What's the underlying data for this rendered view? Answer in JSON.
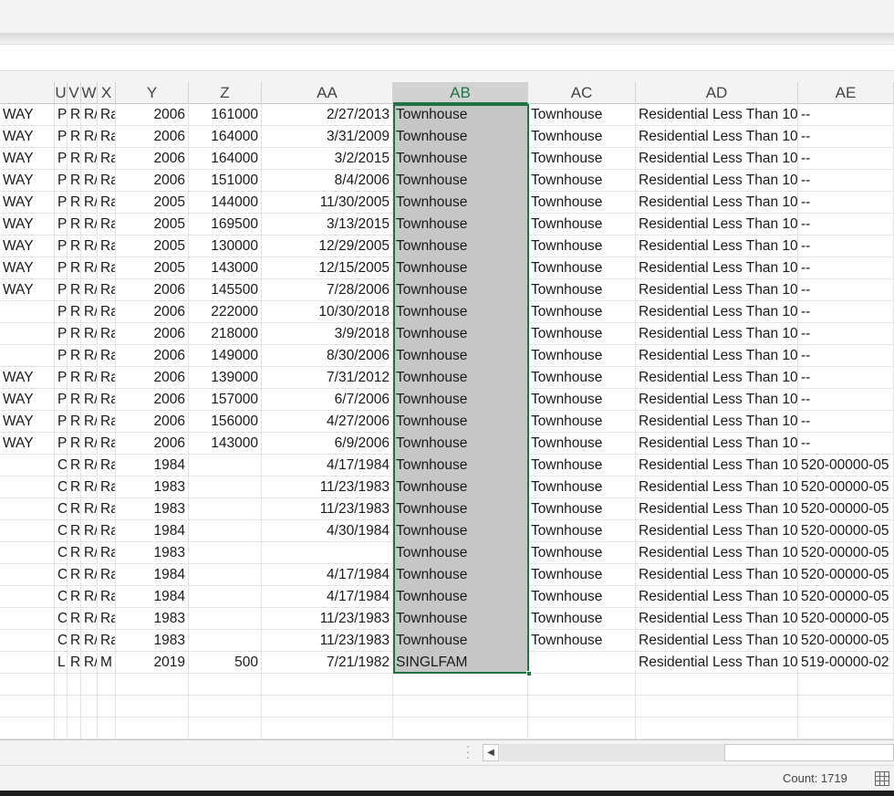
{
  "columns": [
    "",
    "U",
    "V",
    "W",
    "X",
    "Y",
    "Z",
    "AA",
    "AB",
    "AC",
    "AD",
    "AE"
  ],
  "selected_column": "AB",
  "rows": [
    [
      "WAY",
      "P",
      "R/",
      "R/",
      "Ra",
      "2006",
      "161000",
      "2/27/2013",
      "Townhouse",
      "Townhouse",
      "Residential Less Than 10",
      "--"
    ],
    [
      "WAY",
      "P",
      "R/",
      "R/",
      "Ra",
      "2006",
      "164000",
      "3/31/2009",
      "Townhouse",
      "Townhouse",
      "Residential Less Than 10",
      "--"
    ],
    [
      "WAY",
      "P",
      "R/",
      "R/",
      "Ra",
      "2006",
      "164000",
      "3/2/2015",
      "Townhouse",
      "Townhouse",
      "Residential Less Than 10",
      "--"
    ],
    [
      "WAY",
      "P",
      "R/",
      "R/",
      "Ra",
      "2006",
      "151000",
      "8/4/2006",
      "Townhouse",
      "Townhouse",
      "Residential Less Than 10",
      "--"
    ],
    [
      "WAY",
      "P",
      "R/",
      "R/",
      "Ra",
      "2005",
      "144000",
      "11/30/2005",
      "Townhouse",
      "Townhouse",
      "Residential Less Than 10",
      "--"
    ],
    [
      "WAY",
      "P",
      "R/",
      "R/",
      "Ra",
      "2005",
      "169500",
      "3/13/2015",
      "Townhouse",
      "Townhouse",
      "Residential Less Than 10",
      "--"
    ],
    [
      "WAY",
      "P",
      "R/",
      "R/",
      "Ra",
      "2005",
      "130000",
      "12/29/2005",
      "Townhouse",
      "Townhouse",
      "Residential Less Than 10",
      "--"
    ],
    [
      "WAY",
      "P",
      "R/",
      "R/",
      "Ra",
      "2005",
      "143000",
      "12/15/2005",
      "Townhouse",
      "Townhouse",
      "Residential Less Than 10",
      "--"
    ],
    [
      "WAY",
      "P",
      "R/",
      "R/",
      "Ra",
      "2006",
      "145500",
      "7/28/2006",
      "Townhouse",
      "Townhouse",
      "Residential Less Than 10",
      "--"
    ],
    [
      "",
      "P",
      "R/",
      "R/",
      "Ra",
      "2006",
      "222000",
      "10/30/2018",
      "Townhouse",
      "Townhouse",
      "Residential Less Than 10",
      "--"
    ],
    [
      "",
      "P",
      "R/",
      "R/",
      "Ra",
      "2006",
      "218000",
      "3/9/2018",
      "Townhouse",
      "Townhouse",
      "Residential Less Than 10",
      "--"
    ],
    [
      "",
      "P",
      "R/",
      "R/",
      "Ra",
      "2006",
      "149000",
      "8/30/2006",
      "Townhouse",
      "Townhouse",
      "Residential Less Than 10",
      "--"
    ],
    [
      "WAY",
      "P",
      "R/",
      "R/",
      "Ra",
      "2006",
      "139000",
      "7/31/2012",
      "Townhouse",
      "Townhouse",
      "Residential Less Than 10",
      "--"
    ],
    [
      "WAY",
      "P",
      "R/",
      "R/",
      "Ra",
      "2006",
      "157000",
      "6/7/2006",
      "Townhouse",
      "Townhouse",
      "Residential Less Than 10",
      "--"
    ],
    [
      "WAY",
      "P",
      "R/",
      "R/",
      "Ra",
      "2006",
      "156000",
      "4/27/2006",
      "Townhouse",
      "Townhouse",
      "Residential Less Than 10",
      "--"
    ],
    [
      "WAY",
      "P",
      "R/",
      "R/",
      "Ra",
      "2006",
      "143000",
      "6/9/2006",
      "Townhouse",
      "Townhouse",
      "Residential Less Than 10",
      "--"
    ],
    [
      "",
      "C",
      "R/",
      "R/",
      "Ra",
      "1984",
      "",
      "4/17/1984",
      "Townhouse",
      "Townhouse",
      "Residential Less Than 10",
      "520-00000-05"
    ],
    [
      "",
      "C",
      "R/",
      "R/",
      "Ra",
      "1983",
      "",
      "11/23/1983",
      "Townhouse",
      "Townhouse",
      "Residential Less Than 10",
      "520-00000-05"
    ],
    [
      "",
      "C",
      "R/",
      "R/",
      "Ra",
      "1983",
      "",
      "11/23/1983",
      "Townhouse",
      "Townhouse",
      "Residential Less Than 10",
      "520-00000-05"
    ],
    [
      "",
      "C",
      "R/",
      "R/",
      "Ra",
      "1984",
      "",
      "4/30/1984",
      "Townhouse",
      "Townhouse",
      "Residential Less Than 10",
      "520-00000-05"
    ],
    [
      "",
      "C",
      "R/",
      "R/",
      "Ra",
      "1983",
      "",
      "",
      "Townhouse",
      "Townhouse",
      "Residential Less Than 10",
      "520-00000-05"
    ],
    [
      "",
      "C",
      "R/",
      "R/",
      "Ra",
      "1984",
      "",
      "4/17/1984",
      "Townhouse",
      "Townhouse",
      "Residential Less Than 10",
      "520-00000-05"
    ],
    [
      "",
      "C",
      "R/",
      "R/",
      "Ra",
      "1984",
      "",
      "4/17/1984",
      "Townhouse",
      "Townhouse",
      "Residential Less Than 10",
      "520-00000-05"
    ],
    [
      "",
      "C",
      "R/",
      "R/",
      "Ra",
      "1983",
      "",
      "11/23/1983",
      "Townhouse",
      "Townhouse",
      "Residential Less Than 10",
      "520-00000-05"
    ],
    [
      "",
      "C",
      "R/",
      "R/",
      "Ra",
      "1983",
      "",
      "11/23/1983",
      "Townhouse",
      "Townhouse",
      "Residential Less Than 10",
      "520-00000-05"
    ],
    [
      "",
      "L",
      "R/",
      "R/",
      "M",
      "2019",
      "500",
      "7/21/1982",
      "SINGLFAM",
      "",
      "Residential Less Than 10",
      "519-00000-02"
    ],
    [
      "",
      "",
      "",
      "",
      "",
      "",
      "",
      "",
      "",
      "",
      "",
      ""
    ],
    [
      "",
      "",
      "",
      "",
      "",
      "",
      "",
      "",
      "",
      "",
      "",
      ""
    ],
    [
      "",
      "",
      "",
      "",
      "",
      "",
      "",
      "",
      "",
      "",
      "",
      ""
    ]
  ],
  "status": {
    "count_label": "Count: 1719"
  },
  "icons": {
    "view_normal": "normal-view-icon",
    "scroll_left": "scroll-left-icon",
    "sheet_splitter": "more-dots-icon"
  },
  "colors": {
    "accent": "#217346",
    "selected_fill": "#c6c6c6"
  }
}
